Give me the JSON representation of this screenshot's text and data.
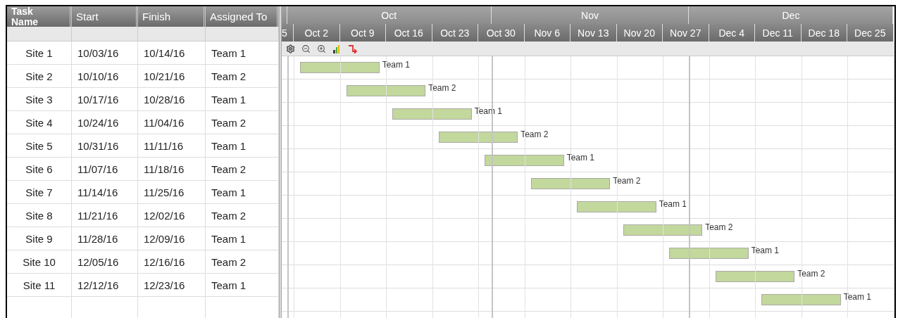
{
  "columns": [
    "Task Name",
    "Start",
    "Finish",
    "Assigned To"
  ],
  "months": [
    {
      "label": "Oct"
    },
    {
      "label": "Nov"
    },
    {
      "label": "Dec"
    }
  ],
  "weeks": [
    "5",
    "Oct 2",
    "Oct 9",
    "Oct 16",
    "Oct 23",
    "Oct 30",
    "Nov 6",
    "Nov 13",
    "Nov 20",
    "Nov 27",
    "Dec 4",
    "Dec 11",
    "Dec 18",
    "Dec 25"
  ],
  "rows": [
    {
      "task": "Site 1",
      "start": "10/03/16",
      "finish": "10/14/16",
      "assigned": "Team 1",
      "bar_label": "Team 1"
    },
    {
      "task": "Site 2",
      "start": "10/10/16",
      "finish": "10/21/16",
      "assigned": "Team 2",
      "bar_label": "Team 2"
    },
    {
      "task": "Site 3",
      "start": "10/17/16",
      "finish": "10/28/16",
      "assigned": "Team 1",
      "bar_label": "Team 1"
    },
    {
      "task": "Site 4",
      "start": "10/24/16",
      "finish": "11/04/16",
      "assigned": "Team 2",
      "bar_label": "Team 2"
    },
    {
      "task": "Site 5",
      "start": "10/31/16",
      "finish": "11/11/16",
      "assigned": "Team 1",
      "bar_label": "Team 1"
    },
    {
      "task": "Site 6",
      "start": "11/07/16",
      "finish": "11/18/16",
      "assigned": "Team 2",
      "bar_label": "Team 2"
    },
    {
      "task": "Site 7",
      "start": "11/14/16",
      "finish": "11/25/16",
      "assigned": "Team 1",
      "bar_label": "Team 1"
    },
    {
      "task": "Site 8",
      "start": "11/21/16",
      "finish": "12/02/16",
      "assigned": "Team 2",
      "bar_label": "Team 2"
    },
    {
      "task": "Site 9",
      "start": "11/28/16",
      "finish": "12/09/16",
      "assigned": "Team 1",
      "bar_label": "Team 1"
    },
    {
      "task": "Site 10",
      "start": "12/05/16",
      "finish": "12/16/16",
      "assigned": "Team 2",
      "bar_label": "Team 2"
    },
    {
      "task": "Site 11",
      "start": "12/12/16",
      "finish": "12/23/16",
      "assigned": "Team 1",
      "bar_label": "Team 1"
    }
  ]
}
